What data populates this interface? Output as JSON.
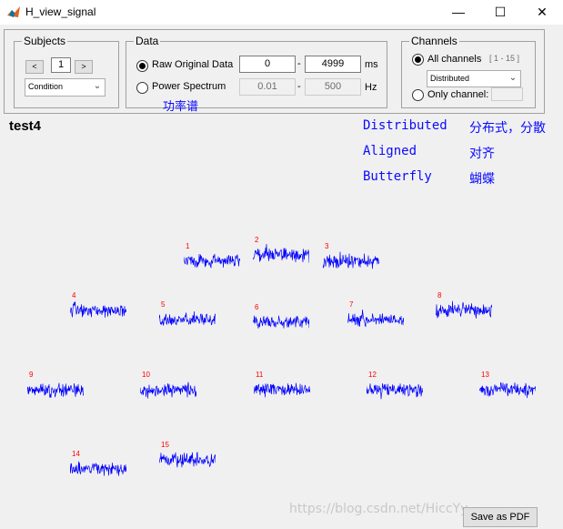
{
  "window": {
    "title": "H_view_signal",
    "minimize": "—",
    "maximize": "☐",
    "close": "✕",
    "icon": "matlab-icon"
  },
  "subjects": {
    "legend": "Subjects",
    "prev": "<",
    "index": "1",
    "next": ">",
    "dropdown": "Condition"
  },
  "data_group": {
    "legend": "Data",
    "raw_label": "Raw Original Data",
    "raw_from": "0",
    "raw_dash": "-",
    "raw_to": "4999",
    "raw_unit": "ms",
    "power_label": "Power Spectrum",
    "power_from": "0.01",
    "power_dash": "-",
    "power_to": "500",
    "power_unit": "Hz",
    "selected": "raw"
  },
  "channels": {
    "legend": "Channels",
    "all_label": "All channels",
    "range": "[ 1 - 15 ]",
    "layout_dropdown": "Distributed",
    "only_label": "Only channel:",
    "selected": "all"
  },
  "plot": {
    "subject_title": "test4",
    "annotations": [
      {
        "en": "Distributed",
        "zh": "分布式，分散"
      },
      {
        "en": "Aligned",
        "zh": "对齐"
      },
      {
        "en": "Butterfly",
        "zh": "蝴蝶"
      }
    ],
    "power_note": "功率谱",
    "signal_color": "#0000ff",
    "channel_label_color": "#ff0000",
    "channels": [
      "1",
      "2",
      "3",
      "4",
      "5",
      "6",
      "7",
      "8",
      "9",
      "10",
      "11",
      "12",
      "13",
      "14",
      "15"
    ]
  },
  "save_button": "Save as PDF",
  "watermark": "https://blog.csdn.net/HiccYy_"
}
